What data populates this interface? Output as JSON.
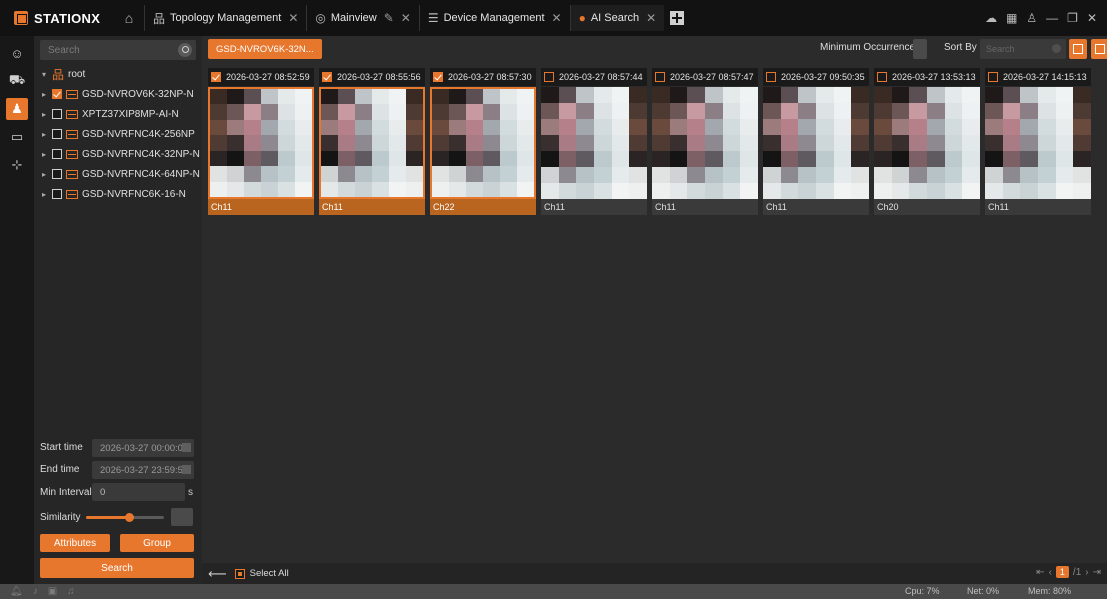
{
  "app": {
    "name": "STATIONX"
  },
  "tabs": [
    {
      "label": "Topology Management",
      "icon": "topology-icon"
    },
    {
      "label": "Mainview",
      "icon": "mainview-icon"
    },
    {
      "label": "Device Management",
      "icon": "device-icon"
    },
    {
      "label": "AI Search",
      "icon": "person-search-icon",
      "active": true
    }
  ],
  "left": {
    "search_placeholder": "Search",
    "tree": {
      "root": "root",
      "devices": [
        {
          "name": "GSD-NVROV6K-32NP-N",
          "checked": true
        },
        {
          "name": "XPTZ37XIP8MP-AI-N",
          "checked": false
        },
        {
          "name": "GSD-NVRFNC4K-256NP",
          "checked": false
        },
        {
          "name": "GSD-NVRFNC4K-32NP-N",
          "checked": false
        },
        {
          "name": "GSD-NVRFNC4K-64NP-N",
          "checked": false
        },
        {
          "name": "GSD-NVRFNC6K-16-N",
          "checked": false
        }
      ]
    },
    "filters": {
      "start_label": "Start time",
      "start_value": "2026-03-27 00:00:00",
      "end_label": "End time",
      "end_value": "2026-03-27 23:59:59",
      "interval_label": "Min Interval",
      "interval_value": "0",
      "interval_unit": "s",
      "similarity_label": "Similarity",
      "similarity_level": 0.55
    },
    "buttons": {
      "attributes": "Attributes",
      "group": "Group",
      "search": "Search"
    }
  },
  "main": {
    "device_chip": "GSD-NVROV6K-32N...",
    "min_occ_label": "Minimum Occurrences",
    "sort_label": "Sort By",
    "sort_placeholder": "Search",
    "cards": [
      {
        "time": "2026-03-27 08:52:59",
        "channel": "Ch11",
        "selected": true
      },
      {
        "time": "2026-03-27 08:55:56",
        "channel": "Ch11",
        "selected": true
      },
      {
        "time": "2026-03-27 08:57:30",
        "channel": "Ch22",
        "selected": true
      },
      {
        "time": "2026-03-27 08:57:44",
        "channel": "Ch11",
        "selected": false
      },
      {
        "time": "2026-03-27 08:57:47",
        "channel": "Ch11",
        "selected": false
      },
      {
        "time": "2026-03-27 09:50:35",
        "channel": "Ch11",
        "selected": false
      },
      {
        "time": "2026-03-27 13:53:13",
        "channel": "Ch20",
        "selected": false
      },
      {
        "time": "2026-03-27 14:15:13",
        "channel": "Ch11",
        "selected": false
      }
    ],
    "select_all_label": "Select All",
    "pager": {
      "current": "1",
      "total": "/1"
    }
  },
  "status": {
    "cpu": "Cpu: 7%",
    "net": "Net: 0%",
    "mem": "Mem: 80%"
  },
  "colors": {
    "accent": "#e8772e",
    "background": "#2b2b2b"
  }
}
